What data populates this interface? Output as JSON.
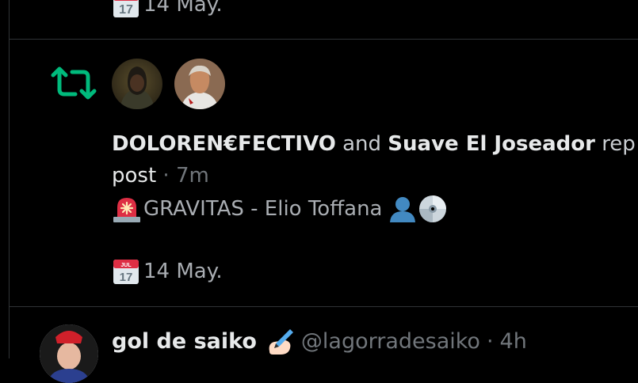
{
  "top_post": {
    "date_text": "14 May."
  },
  "repost": {
    "reposter_1": "DOLOREN€FECTIVO",
    "connector": "and",
    "reposter_2": "Suave El Joseador",
    "action_partial": "rep",
    "action_wrapped": "post",
    "separator": "·",
    "time": "7m",
    "content_text": "GRAVITAS - Elio Toffana",
    "date_text": "14 May.",
    "calendar_month": "JUL",
    "calendar_day": "17"
  },
  "next_post": {
    "author_name": "gol de saiko",
    "handle": "@lagorradesaiko",
    "separator": "·",
    "time": "4h"
  },
  "colors": {
    "background": "#000000",
    "divider": "#2f3336",
    "retweet_green": "#00ba7c",
    "muted_text": "#71767b"
  },
  "icons": [
    "retweet-icon",
    "calendar-icon",
    "siren-icon",
    "bust-icon",
    "disc-icon",
    "writing-hand-icon"
  ]
}
